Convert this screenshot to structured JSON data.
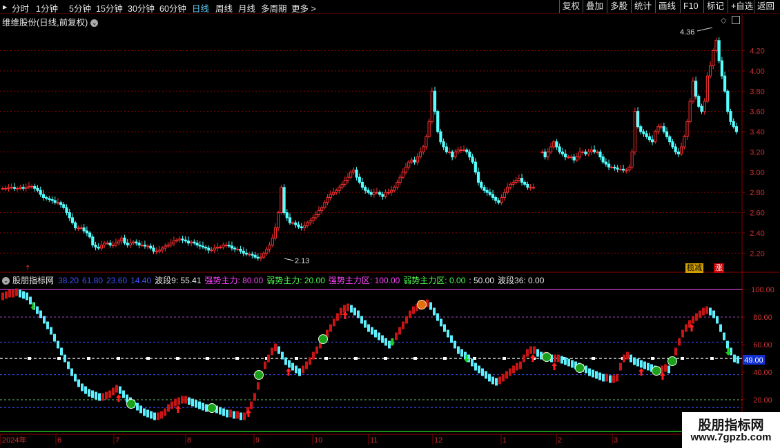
{
  "toolbar": {
    "periods": [
      "分时",
      "1分钟",
      "5分钟",
      "15分钟",
      "30分钟",
      "60分钟",
      "日线",
      "周线",
      "月线",
      "多周期",
      "更多"
    ],
    "active_period": "日线",
    "buttons": [
      "复权",
      "叠加",
      "多股",
      "统计",
      "画线",
      "F10",
      "标记",
      "+自选",
      "返回"
    ]
  },
  "stock": {
    "title": "维维股份(日线,前复权)",
    "high_label": "4.36",
    "low_label": "2.13",
    "price_ticks": [
      "4.20",
      "4.00",
      "3.80",
      "3.60",
      "3.40",
      "3.20",
      "3.00",
      "2.80",
      "2.60",
      "2.40",
      "2.20"
    ],
    "tag_left": "榄减",
    "tag_right": "涨"
  },
  "indicator": {
    "name": "股朋指标网",
    "values": [
      {
        "text": "38.20",
        "color": "#3b53ff"
      },
      {
        "text": "61.80",
        "color": "#3b53ff"
      },
      {
        "text": "23.60",
        "color": "#3b53ff"
      },
      {
        "text": "14.40",
        "color": "#3b53ff"
      },
      {
        "text": "波段9: 55.41",
        "color": "#e6e6e6"
      },
      {
        "text": "强势主力: 80.00",
        "color": "#ff40ff"
      },
      {
        "text": "弱势主力: 20.00",
        "color": "#4dff4d"
      },
      {
        "text": "强势主力区: 100.00",
        "color": "#ff40ff"
      },
      {
        "text": "弱势主力区: 0.00",
        "color": "#4dff4d"
      },
      {
        "text": ": 50.00",
        "color": "#e6e6e6"
      },
      {
        "text": "波段36: 0.00",
        "color": "#e6e6e6"
      }
    ],
    "ticks": [
      "100.00",
      "80.00",
      "60.00",
      "40.00",
      "20.00"
    ],
    "current_value": "49.00"
  },
  "x_axis": {
    "labels": [
      "2024年",
      "6",
      "7",
      "8",
      "9",
      "10",
      "11",
      "12",
      "1",
      "2",
      "3"
    ]
  },
  "watermark": {
    "line1": "股朋指标网",
    "line2": "www.7gpzb.com"
  },
  "colors": {
    "up": "#ff3030",
    "down": "#54ffff",
    "grid": "#8b0000",
    "osc_up": "#c81414",
    "osc_down": "#5ef0ff"
  },
  "chart_data": [
    {
      "type": "candlestick",
      "title": "维维股份(日线,前复权)",
      "ylim": [
        2.1,
        4.36
      ],
      "annotations": {
        "high": 4.36,
        "low": 2.13
      },
      "close_series_approx": [
        2.84,
        2.84,
        2.85,
        2.85,
        2.84,
        2.84,
        2.85,
        2.84,
        2.85,
        2.86,
        2.86,
        2.84,
        2.82,
        2.78,
        2.75,
        2.74,
        2.73,
        2.72,
        2.7,
        2.7,
        2.68,
        2.65,
        2.6,
        2.55,
        2.5,
        2.45,
        2.45,
        2.45,
        2.42,
        2.4,
        2.36,
        2.28,
        2.26,
        2.25,
        2.28,
        2.3,
        2.3,
        2.28,
        2.28,
        2.3,
        2.32,
        2.35,
        2.3,
        2.28,
        2.3,
        2.31,
        2.3,
        2.28,
        2.28,
        2.27,
        2.27,
        2.25,
        2.22,
        2.22,
        2.23,
        2.25,
        2.27,
        2.28,
        2.3,
        2.32,
        2.33,
        2.34,
        2.33,
        2.32,
        2.3,
        2.31,
        2.3,
        2.28,
        2.27,
        2.26,
        2.25,
        2.23,
        2.23,
        2.25,
        2.26,
        2.26,
        2.28,
        2.28,
        2.27,
        2.25,
        2.24,
        2.24,
        2.22,
        2.2,
        2.19,
        2.19,
        2.18,
        2.16,
        2.15,
        2.16,
        2.2,
        2.24,
        2.28,
        2.35,
        2.45,
        2.6,
        2.85,
        2.6,
        2.55,
        2.5,
        2.5,
        2.48,
        2.46,
        2.45,
        2.47,
        2.5,
        2.52,
        2.55,
        2.58,
        2.62,
        2.65,
        2.7,
        2.75,
        2.78,
        2.8,
        2.82,
        2.85,
        2.88,
        2.92,
        2.95,
        3.0,
        3.02,
        2.95,
        2.9,
        2.85,
        2.82,
        2.8,
        2.78,
        2.8,
        2.8,
        2.78,
        2.76,
        2.8,
        2.8,
        2.82,
        2.85,
        2.9,
        2.95,
        3.0,
        3.05,
        3.1,
        3.12,
        3.1,
        3.15,
        3.2,
        3.25,
        3.35,
        3.5,
        3.8,
        3.6,
        3.4,
        3.3,
        3.25,
        3.2,
        3.2,
        3.15,
        3.2,
        3.22,
        3.22,
        3.22,
        3.2,
        3.15,
        3.1,
        3.0,
        2.9,
        2.85,
        2.82,
        2.8,
        2.78,
        2.75,
        2.72,
        2.7,
        2.75,
        2.8,
        2.85,
        2.88,
        2.9,
        2.92,
        2.94,
        2.9,
        2.88,
        2.85,
        2.85,
        2.85,
        null,
        null,
        3.2,
        3.15,
        3.2,
        3.25,
        3.3,
        3.25,
        3.2,
        3.18,
        3.15,
        3.15,
        3.15,
        3.12,
        3.15,
        3.2,
        3.2,
        3.18,
        3.2,
        3.22,
        3.2,
        3.2,
        3.15,
        3.1,
        3.08,
        3.05,
        3.05,
        3.04,
        3.03,
        3.03,
        3.02,
        3.02,
        3.05,
        3.2,
        3.6,
        3.45,
        3.4,
        3.38,
        3.35,
        3.32,
        3.3,
        3.4,
        3.45,
        3.45,
        3.4,
        3.35,
        3.3,
        3.25,
        3.2,
        3.18,
        3.25,
        3.35,
        3.5,
        3.7,
        3.9,
        3.75,
        3.65,
        3.6,
        3.7,
        3.95,
        4.05,
        4.2,
        4.3,
        4.1,
        3.95,
        3.8,
        3.6,
        3.5,
        3.45,
        3.4
      ]
    },
    {
      "type": "line",
      "title": "股朋指标网",
      "ylim": [
        0,
        105
      ],
      "reference_lines": [
        100,
        80,
        61.8,
        50,
        38.2,
        20,
        14.4
      ],
      "current": 49.0,
      "series": [
        {
          "name": "波段9",
          "values": [
            95,
            96,
            97,
            97,
            98,
            97,
            96,
            95,
            92,
            88,
            85,
            82,
            78,
            74,
            70,
            65,
            60,
            55,
            50,
            45,
            40,
            36,
            32,
            29,
            27,
            25,
            24,
            23,
            22,
            22,
            23,
            24,
            26,
            28,
            27,
            24,
            21,
            19,
            17,
            15,
            13,
            11,
            10,
            9,
            8,
            8,
            9,
            11,
            14,
            16,
            18,
            19,
            20,
            20,
            19,
            18,
            17,
            16,
            15,
            14,
            14,
            14,
            13,
            12,
            11,
            10,
            10,
            9,
            9,
            8,
            8,
            12,
            16,
            22,
            30,
            38,
            45,
            50,
            55,
            58,
            56,
            52,
            48,
            46,
            44,
            42,
            40,
            42,
            45,
            48,
            52,
            56,
            60,
            64,
            68,
            72,
            76,
            80,
            84,
            86,
            87,
            86,
            84,
            82,
            78,
            75,
            72,
            70,
            68,
            66,
            64,
            62,
            60,
            62,
            66,
            70,
            74,
            78,
            82,
            85,
            87,
            88,
            89,
            90,
            88,
            84,
            80,
            76,
            72,
            68,
            64,
            60,
            56,
            54,
            52,
            50,
            47,
            44,
            42,
            40,
            38,
            36,
            34,
            33,
            34,
            36,
            38,
            40,
            42,
            44,
            45,
            50,
            54,
            56,
            56,
            54,
            52,
            52,
            51,
            50,
            50,
            50,
            49,
            48,
            47,
            46,
            45,
            44,
            43,
            42,
            40,
            39,
            38,
            37,
            36,
            36,
            35,
            35,
            36,
            44,
            50,
            52,
            50,
            48,
            47,
            46,
            45,
            44,
            43,
            42,
            41,
            42,
            43,
            42,
            48,
            55,
            62,
            68,
            72,
            75,
            78,
            80,
            82,
            84,
            85,
            84,
            82,
            78,
            72,
            66,
            60,
            55,
            50,
            49
          ]
        }
      ]
    }
  ]
}
